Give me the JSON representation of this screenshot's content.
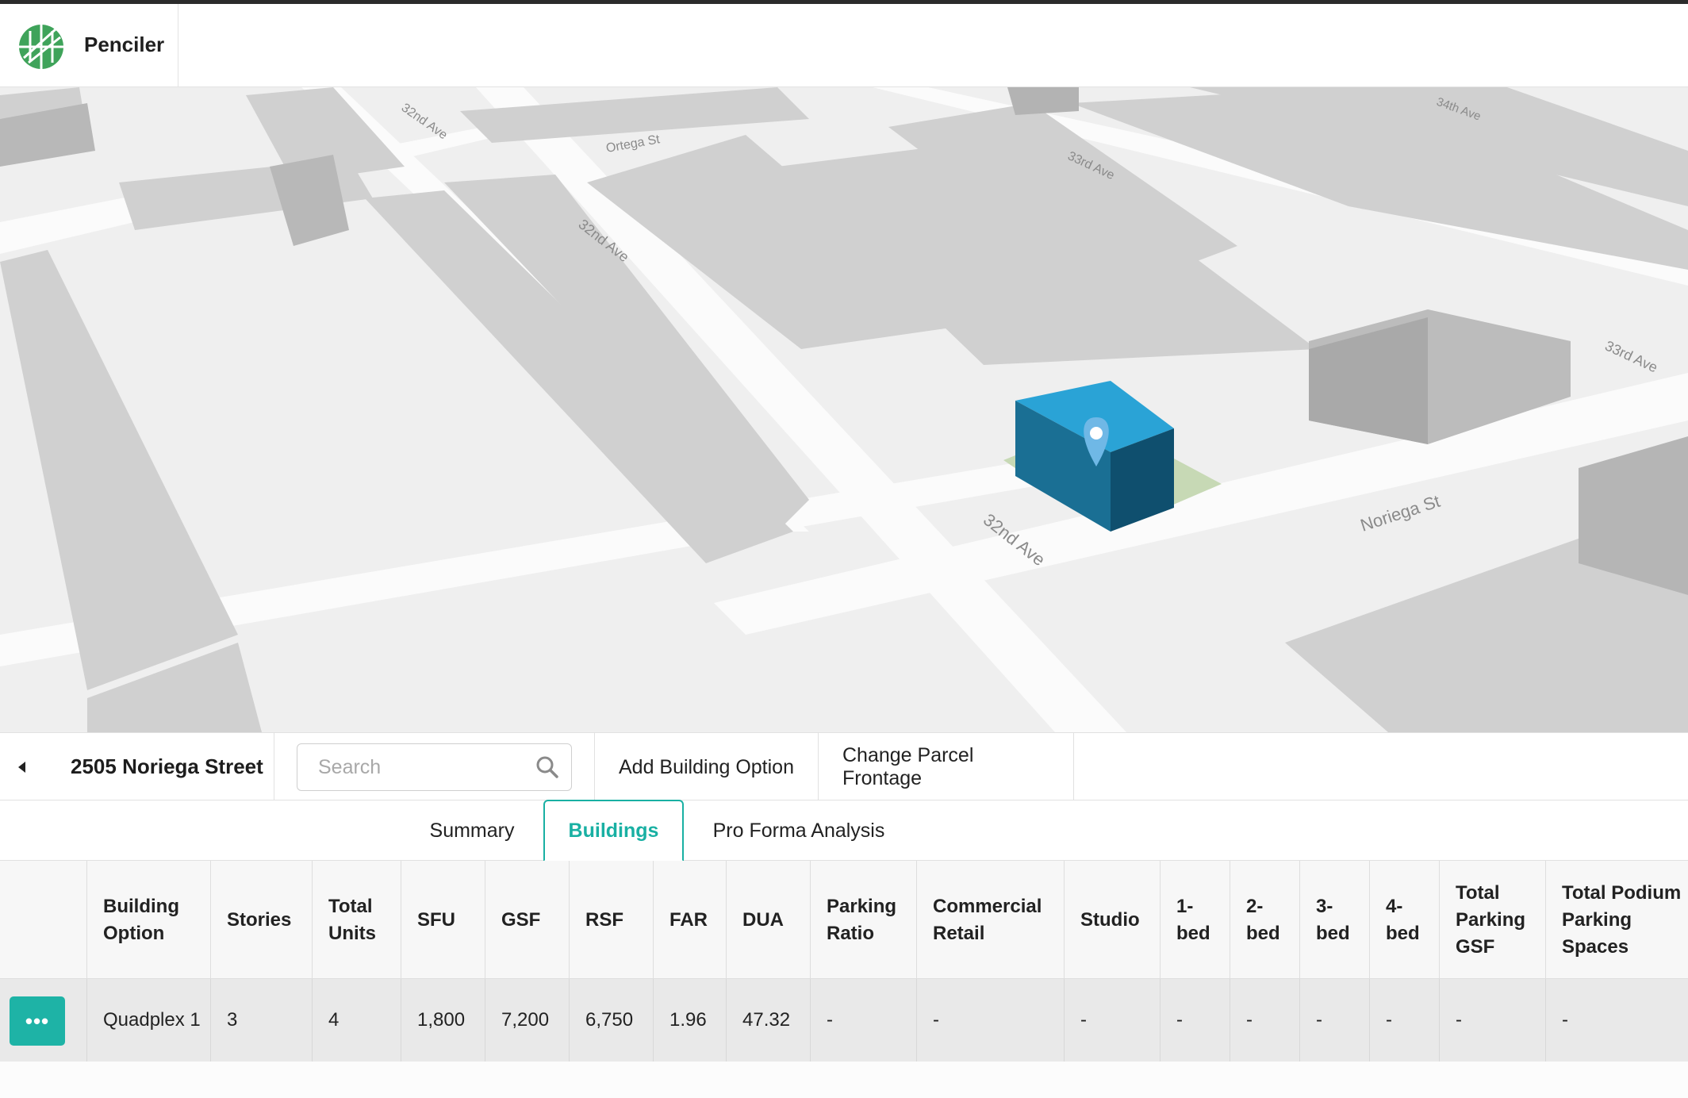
{
  "app": {
    "name": "Penciler"
  },
  "map": {
    "street_labels": {
      "s1": "32nd Ave",
      "s2": "Ortega St",
      "s3": "33rd Ave",
      "s4": "34th Ave",
      "s5": "32nd Ave",
      "s6": "33rd Ave",
      "s7": "32nd Ave",
      "s8": "Noriega St"
    }
  },
  "toolbar": {
    "address": "2505 Noriega Street",
    "search_placeholder": "Search",
    "add_building_label": "Add Building Option",
    "change_frontage_label": "Change Parcel Frontage"
  },
  "tabs": {
    "summary": "Summary",
    "buildings": "Buildings",
    "pro_forma": "Pro Forma Analysis"
  },
  "table": {
    "headers": {
      "building_option": "Building Option",
      "stories": "Stories",
      "total_units": "Total Units",
      "sfu": "SFU",
      "gsf": "GSF",
      "rsf": "RSF",
      "far": "FAR",
      "dua": "DUA",
      "parking_ratio": "Parking Ratio",
      "commercial_retail": "Commercial Retail",
      "studio": "Studio",
      "bed1": "1-\nbed",
      "bed2": "2-\nbed",
      "bed3": "3-\nbed",
      "bed4": "4-\nbed",
      "total_parking_gsf": "Total Parking GSF",
      "total_podium": "Total Podium Parking Spaces"
    },
    "rows": [
      {
        "actions_label": "•••",
        "building_option": "Quadplex 1",
        "stories": "3",
        "total_units": "4",
        "sfu": "1,800",
        "gsf": "7,200",
        "rsf": "6,750",
        "far": "1.96",
        "dua": "47.32",
        "parking_ratio": "-",
        "commercial_retail": "-",
        "studio": "-",
        "bed1": "-",
        "bed2": "-",
        "bed3": "-",
        "bed4": "-",
        "total_parking_gsf": "-",
        "total_podium": "-"
      }
    ]
  },
  "colors": {
    "accent": "#19b0a3",
    "building_blue": "#1f8fc0",
    "map_block": "#d2d2d2"
  }
}
